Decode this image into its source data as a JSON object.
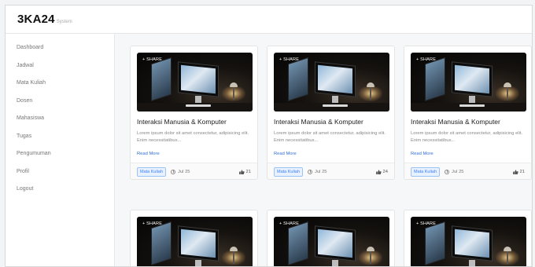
{
  "header": {
    "brand": "3KA24",
    "brand_sub": "System"
  },
  "sidebar": {
    "items": [
      {
        "label": "Dashboard"
      },
      {
        "label": "Jadwal"
      },
      {
        "label": "Mata Kuliah"
      },
      {
        "label": "Dosen"
      },
      {
        "label": "Mahasiswa"
      },
      {
        "label": "Tugas"
      },
      {
        "label": "Pengumuman"
      },
      {
        "label": "Profil"
      },
      {
        "label": "Logout"
      }
    ]
  },
  "cards": [
    {
      "share": "+ SHARE",
      "title": "Interaksi Manusia & Komputer",
      "desc": "Lorem ipsum dolor sit amet consectetur, adipisicing elit. Enim necessitatibus...",
      "more": "Read More",
      "badge": "Mata Kuliah",
      "date": "Jul 25",
      "likes": "21"
    },
    {
      "share": "+ SHARE",
      "title": "Interaksi Manusia & Komputer",
      "desc": "Lorem ipsum dolor sit amet consectetur, adipisicing elit. Enim necessitatibus...",
      "more": "Read More",
      "badge": "Mata Kuliah",
      "date": "Jul 25",
      "likes": "24"
    },
    {
      "share": "+ SHARE",
      "title": "Interaksi Manusia & Komputer",
      "desc": "Lorem ipsum dolor sit amet consectetur, adipisicing elit. Enim necessitatibus...",
      "more": "Read More",
      "badge": "Mata Kuliah",
      "date": "Jul 25",
      "likes": "21"
    },
    {
      "share": "+ SHARE"
    },
    {
      "share": "+ SHARE"
    },
    {
      "share": "+ SHARE"
    }
  ],
  "icons": {
    "clock": "clock-icon",
    "like": "thumbs-up-icon"
  },
  "colors": {
    "accent": "#2f6fd6",
    "badge_bg": "#e8f1ff"
  }
}
